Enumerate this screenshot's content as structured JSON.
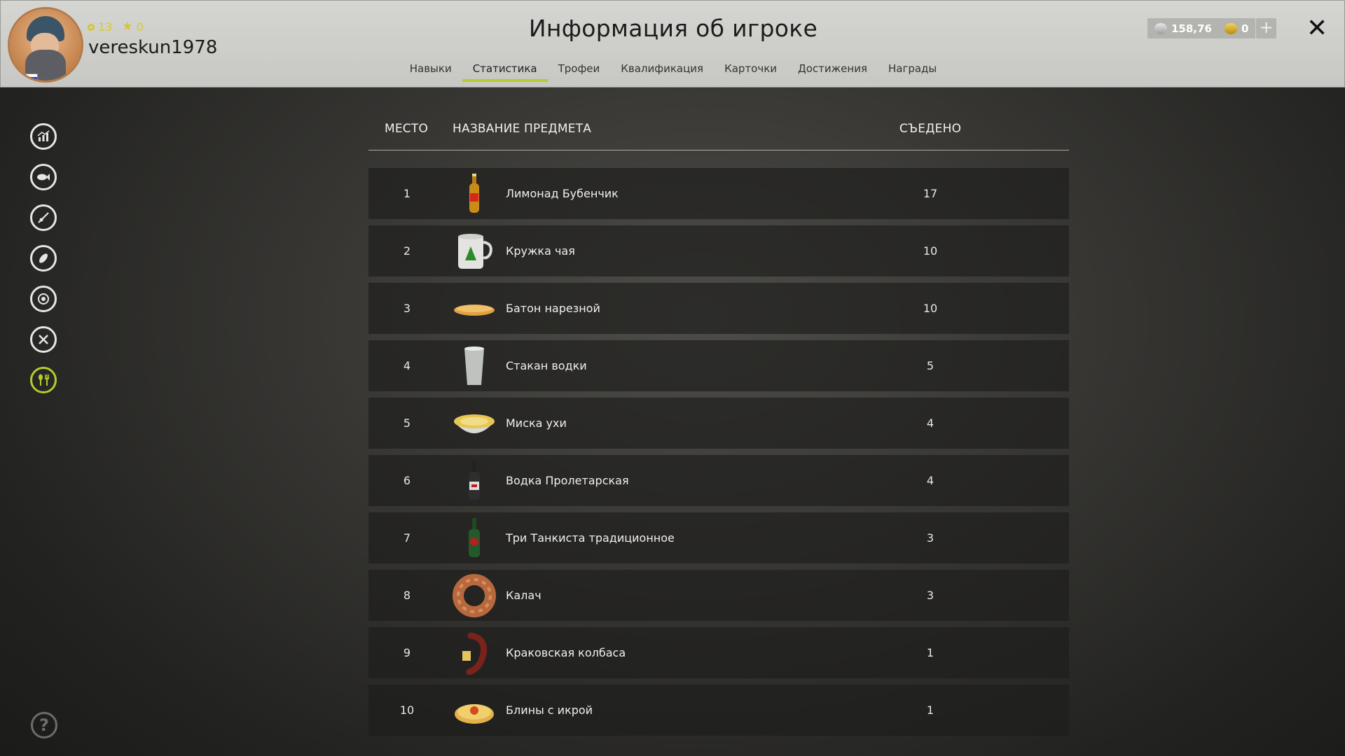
{
  "window": {
    "title": "Информация об игроке",
    "close_label": "✕"
  },
  "player": {
    "username": "vereskun1978",
    "level": "13",
    "stars": "0"
  },
  "tabs": [
    {
      "label": "Навыки",
      "active": false
    },
    {
      "label": "Статистика",
      "active": true
    },
    {
      "label": "Трофеи",
      "active": false
    },
    {
      "label": "Квалификация",
      "active": false
    },
    {
      "label": "Карточки",
      "active": false
    },
    {
      "label": "Достижения",
      "active": false
    },
    {
      "label": "Награды",
      "active": false
    }
  ],
  "currency": {
    "silver": "158,76",
    "gold": "0",
    "add_label": "+"
  },
  "sidebar": {
    "items": [
      {
        "icon": "chart-icon",
        "active": false
      },
      {
        "icon": "fish-icon",
        "active": false
      },
      {
        "icon": "rod-icon",
        "active": false
      },
      {
        "icon": "lure-icon",
        "active": false
      },
      {
        "icon": "reel-icon",
        "active": false
      },
      {
        "icon": "tools-icon",
        "active": false
      },
      {
        "icon": "food-icon",
        "active": true
      }
    ],
    "help_label": "?"
  },
  "table": {
    "headers": {
      "rank": "МЕСТО",
      "name": "НАЗВАНИЕ ПРЕДМЕТА",
      "count": "СЪЕДЕНО"
    },
    "rows": [
      {
        "rank": "1",
        "name": "Лимонад Бубенчик",
        "count": "17",
        "icon": "lemonade-bottle-icon"
      },
      {
        "rank": "2",
        "name": "Кружка чая",
        "count": "10",
        "icon": "tea-mug-icon"
      },
      {
        "rank": "3",
        "name": "Батон нарезной",
        "count": "10",
        "icon": "bread-loaf-icon"
      },
      {
        "rank": "4",
        "name": "Стакан водки",
        "count": "5",
        "icon": "vodka-glass-icon"
      },
      {
        "rank": "5",
        "name": "Миска ухи",
        "count": "4",
        "icon": "soup-bowl-icon"
      },
      {
        "rank": "6",
        "name": "Водка Пролетарская",
        "count": "4",
        "icon": "vodka-bottle-icon"
      },
      {
        "rank": "7",
        "name": "Три Танкиста традиционное",
        "count": "3",
        "icon": "beer-bottle-icon"
      },
      {
        "rank": "8",
        "name": "Калач",
        "count": "3",
        "icon": "kalach-icon"
      },
      {
        "rank": "9",
        "name": "Краковская колбаса",
        "count": "1",
        "icon": "sausage-icon"
      },
      {
        "rank": "10",
        "name": "Блины с икрой",
        "count": "1",
        "icon": "pancakes-icon"
      }
    ]
  },
  "colors": {
    "accent": "#b7cc2d",
    "header_bg": "#d0d0cc",
    "row_bg": "#1e1d1c"
  }
}
